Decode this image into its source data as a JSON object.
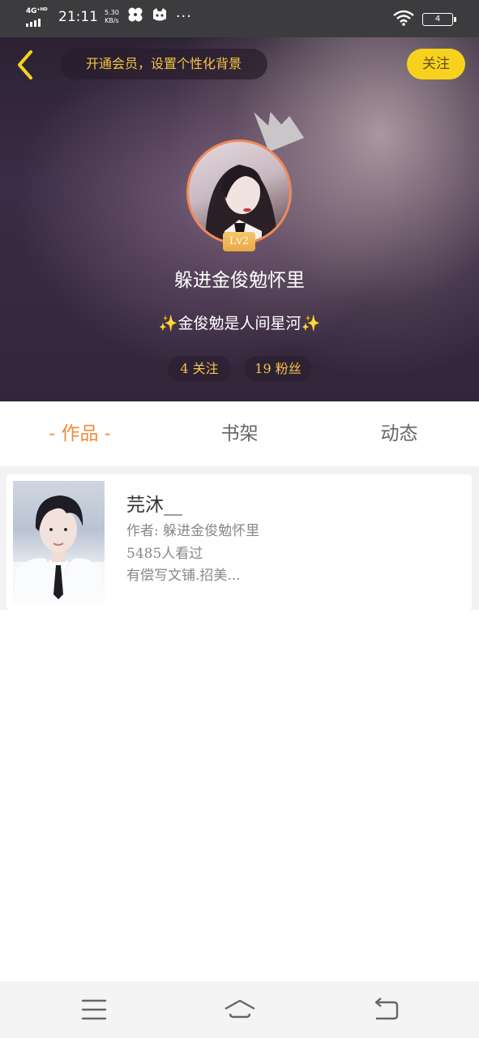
{
  "status_bar": {
    "network": "4G⁺ᴴᴰ",
    "time": "21:11",
    "speed_value": "5.30",
    "speed_unit": "KB/s",
    "more": "···",
    "battery": "4",
    "icons": [
      "signal-icon",
      "pinwheel-icon",
      "cat-app-icon",
      "wifi-icon",
      "battery-icon"
    ]
  },
  "header": {
    "vip_banner": "开通会员，设置个性化背景",
    "follow_button": "关注",
    "level": "Lv2",
    "nickname": "躲进金俊勉怀里",
    "signature_spark": "✨",
    "signature": "金俊勉是人间星河",
    "following": "4 关注",
    "fans": "19 粉丝"
  },
  "tabs": [
    {
      "label": "- 作品 -",
      "active": true
    },
    {
      "label": "书架",
      "active": false
    },
    {
      "label": "动态",
      "active": false
    }
  ],
  "works": [
    {
      "title": "芫沐__",
      "author": "作者: 躲进金俊勉怀里",
      "views": "5485人看过",
      "description": "有偿写文铺.招美..."
    }
  ],
  "colors": {
    "accent_orange": "#f08a3a",
    "follow_yellow": "#f7d21c",
    "gold_text": "#f5c443"
  }
}
